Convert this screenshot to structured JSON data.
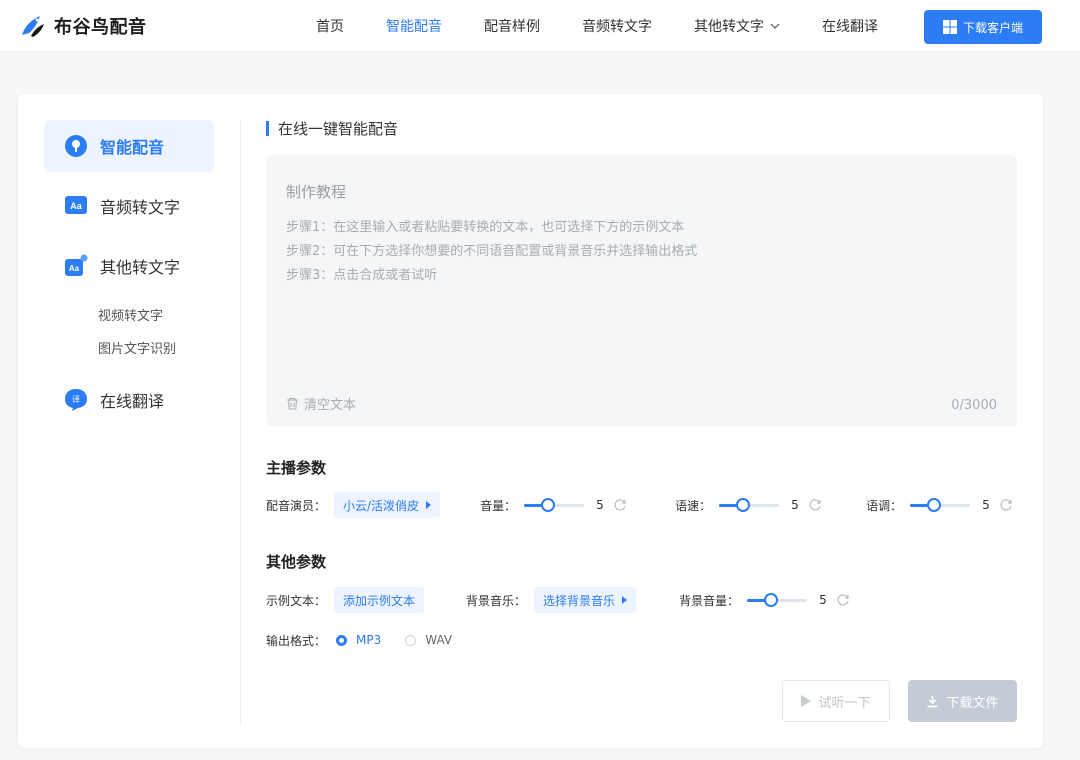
{
  "brand": {
    "name": "布谷鸟配音"
  },
  "nav": {
    "items": [
      {
        "label": "首页"
      },
      {
        "label": "智能配音"
      },
      {
        "label": "配音样例"
      },
      {
        "label": "音频转文字"
      },
      {
        "label": "其他转文字"
      },
      {
        "label": "在线翻译"
      }
    ],
    "active_index": 1,
    "download_label": "下载客户端"
  },
  "sidebar": {
    "items": [
      {
        "label": "智能配音",
        "icon": "mic-icon",
        "active": true
      },
      {
        "label": "音频转文字",
        "icon": "aa-text-icon"
      },
      {
        "label": "其他转文字",
        "icon": "aa-badge-icon",
        "subitems": [
          {
            "label": "视频转文字"
          },
          {
            "label": "图片文字识别"
          }
        ]
      },
      {
        "label": "在线翻译",
        "icon": "translate-icon"
      }
    ]
  },
  "main": {
    "title": "在线一键智能配音",
    "editor": {
      "heading": "制作教程",
      "steps": [
        "步骤1：在这里输入或者粘贴要转换的文本，也可选择下方的示例文本",
        "步骤2：可在下方选择你想要的不同语音配置或背景音乐并选择输出格式",
        "步骤3：点击合成或者试听"
      ],
      "clear_label": "清空文本",
      "counter": "0/3000"
    },
    "anchor_params": {
      "title": "主播参数",
      "voice_label": "配音演员：",
      "voice_value": "小云/活泼俏皮",
      "volume_label": "音量：",
      "volume_value": "5",
      "speed_label": "语速：",
      "speed_value": "5",
      "pitch_label": "语调：",
      "pitch_value": "5"
    },
    "other_params": {
      "title": "其他参数",
      "sample_label": "示例文本：",
      "sample_button": "添加示例文本",
      "bgm_label": "背景音乐：",
      "bgm_button": "选择背景音乐",
      "bgm_volume_label": "背景音量：",
      "bgm_volume_value": "5",
      "format_label": "输出格式：",
      "formats": [
        {
          "label": "MP3",
          "selected": true
        },
        {
          "label": "WAV",
          "selected": false
        }
      ]
    },
    "actions": {
      "try_label": "试听一下",
      "download_label": "下载文件"
    }
  },
  "colors": {
    "accent": "#2b7cf5",
    "disabled": "#c5cbd6",
    "active_bg": "#eef4ff"
  }
}
